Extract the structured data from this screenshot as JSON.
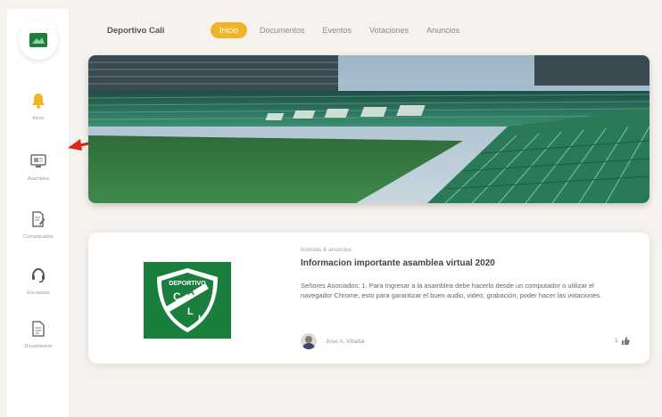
{
  "sidebar": {
    "items": [
      {
        "label": "Inicio",
        "icon": "bell-icon"
      },
      {
        "label": "Asamblea",
        "icon": "monitor-icon"
      },
      {
        "label": "Comunicados",
        "icon": "edit-document-icon"
      },
      {
        "label": "Encuestas",
        "icon": "headset-icon"
      },
      {
        "label": "Documentos",
        "icon": "document-icon"
      }
    ]
  },
  "header": {
    "brand": "Deportivo Cali",
    "tabs": [
      "Inicio",
      "Documentos",
      "Eventos",
      "Votaciones",
      "Anuncios"
    ]
  },
  "card": {
    "category": "Noticias & anuncios",
    "title": "Informacion importante asamblea virtual 2020",
    "body": "Señores Asociados: 1. Para Ingresar a la asamblea debe hacerlo desde un computador o utilizar el navegador Chrome, esto para garantizar el buen audio, video, grabación, poder hacer las votaciones.",
    "author": "Jose A. Villaltal",
    "likes": "1",
    "logo_text": {
      "top": "DEPORTIVO",
      "letters": [
        "C",
        "A",
        "L",
        "I"
      ]
    }
  },
  "colors": {
    "accent": "#f0b429",
    "brand_green": "#1a7f3c",
    "annotation": "#e0241b"
  }
}
